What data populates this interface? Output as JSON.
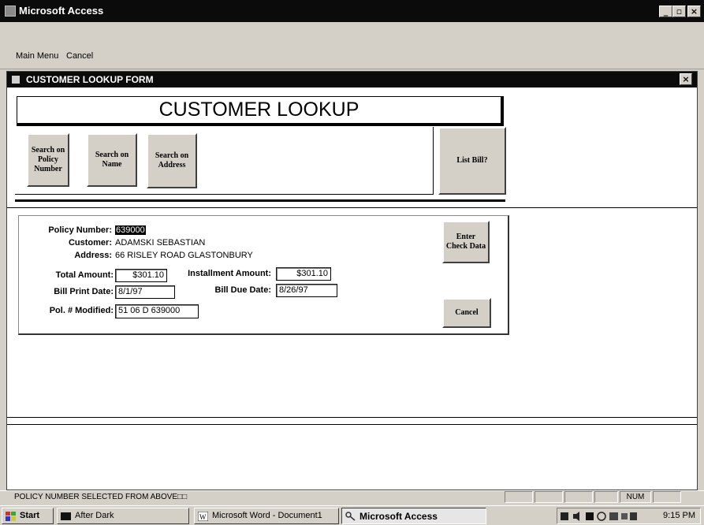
{
  "app": {
    "title": "Microsoft Access",
    "minimize_glyph": "_",
    "maximize_glyph": "▫",
    "close_glyph": "×"
  },
  "menu": {
    "items": [
      {
        "label": "Main Menu"
      },
      {
        "label": "Cancel"
      }
    ]
  },
  "form": {
    "title": "CUSTOMER LOOKUP FORM",
    "close_glyph": "×",
    "header": "CUSTOMER LOOKUP",
    "buttons": {
      "search_policy": "Search on Policy Number",
      "search_name": "Search on Name",
      "search_address": "Search on Address",
      "list_bill": "List Bill?"
    },
    "details": {
      "policy_number_label": "Policy Number:",
      "policy_number_value": "639000",
      "customer_label": "Customer:",
      "customer_value": "ADAMSKI SEBASTIAN",
      "address_label": "Address:",
      "address_value": "66 RISLEY ROAD GLASTONBURY",
      "total_amount_label": "Total Amount:",
      "total_amount_value": "$301.10",
      "installment_amount_label": "Installment Amount:",
      "installment_amount_value": "$301.10",
      "bill_print_date_label": "Bill Print Date:",
      "bill_print_date_value": "8/1/97",
      "bill_due_date_label": "Bill Due Date:",
      "bill_due_date_value": "8/26/97",
      "pol_modified_label": "Pol. # Modified:",
      "pol_modified_value": "51 06 D 639000",
      "enter_check_label": "Enter Check Data",
      "cancel_label": "Cancel"
    }
  },
  "statusbar": {
    "text": "POLICY NUMBER SELECTED FROM ABOVE□□",
    "num": "NUM"
  },
  "taskbar": {
    "start": "Start",
    "tasks": [
      {
        "label": "After Dark"
      },
      {
        "label": "Microsoft Word - Document1"
      },
      {
        "label": "Microsoft Access"
      }
    ],
    "clock": "9:15 PM"
  }
}
